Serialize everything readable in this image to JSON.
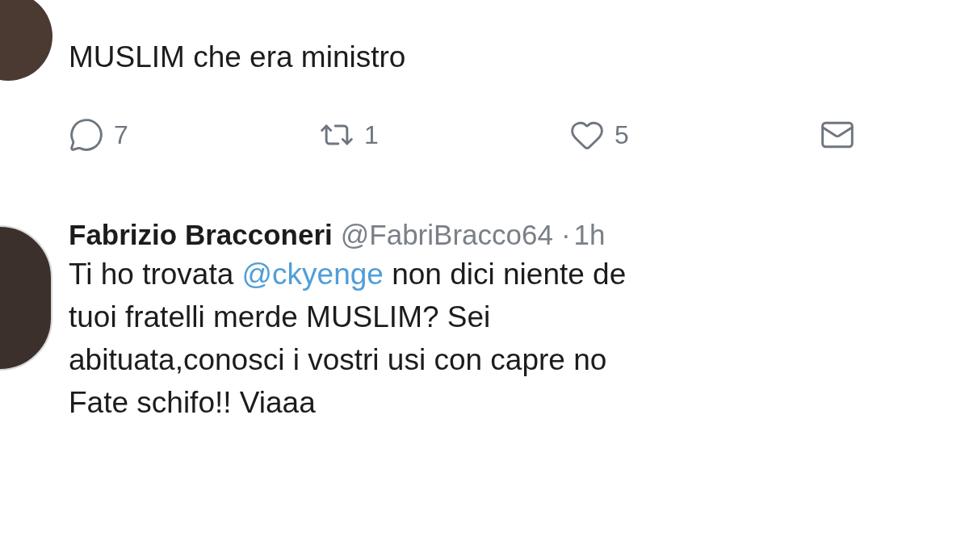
{
  "tweets": [
    {
      "text_lines": [
        [
          {
            "kind": "plain",
            "text": "MUSLIM che era ministro"
          }
        ]
      ],
      "actions": [
        {
          "kind": "reply",
          "count": "7"
        },
        {
          "kind": "retweet",
          "count": "1"
        },
        {
          "kind": "like",
          "count": "5"
        },
        {
          "kind": "message"
        }
      ]
    },
    {
      "author": "Fabrizio Bracconeri",
      "handle": "@FabriBracco64",
      "separator": "·",
      "time": "1h",
      "text_lines": [
        [
          {
            "kind": "plain",
            "text": "Ti ho trovata "
          },
          {
            "kind": "mention",
            "text": "@ckyenge"
          },
          {
            "kind": "plain",
            "text": " non dici niente de"
          }
        ],
        [
          {
            "kind": "plain",
            "text": "tuoi fratelli merde MUSLIM? Sei"
          }
        ],
        [
          {
            "kind": "plain",
            "text": "abituata,conosci i vostri usi con capre no"
          }
        ],
        [
          {
            "kind": "plain",
            "text": "Fate schifo!! Viaaa"
          }
        ]
      ]
    }
  ]
}
